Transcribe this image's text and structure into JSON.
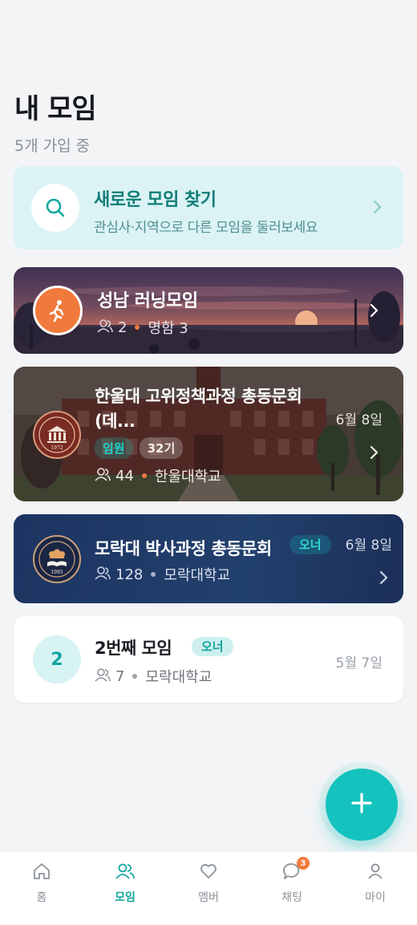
{
  "header": {
    "title": "내 모임",
    "subtitle": "5개 가입 중"
  },
  "discover": {
    "title": "새로운 모임 찾기",
    "description": "관심사·지역으로 다른 모임을 둘러보세요",
    "icon": "search-icon"
  },
  "groups": [
    {
      "name": "성남 러닝모임",
      "members": "2",
      "location": "명함 3",
      "avatar_icon": "runner-icon",
      "date": ""
    },
    {
      "name": "한울대 고위정책과정 총동문회 (데...",
      "members": "44",
      "location": "한울대학교",
      "date": "6월 8일",
      "tags": [
        "임원",
        "32기"
      ],
      "avatar_icon": "university-emblem-icon",
      "avatar_text": "1972"
    },
    {
      "name": "모락대 박사과정 총동문회",
      "members": "128",
      "location": "모락대학교",
      "date": "6월 8일",
      "role": "오너",
      "avatar_icon": "university-emblem-icon",
      "avatar_text": "1985"
    },
    {
      "name": "2번째 모임",
      "members": "7",
      "location": "모락대학교",
      "date": "5월 7일",
      "role": "오너",
      "avatar_text": "2"
    }
  ],
  "fab": {
    "icon": "plus-icon"
  },
  "tabbar": {
    "items": [
      {
        "label": "홈",
        "icon": "home-icon"
      },
      {
        "label": "모임",
        "icon": "people-icon",
        "active": true
      },
      {
        "label": "멤버",
        "icon": "heart-icon"
      },
      {
        "label": "채팅",
        "icon": "chat-icon",
        "badge": "3"
      },
      {
        "label": "마이",
        "icon": "person-icon"
      }
    ]
  },
  "colors": {
    "accent": "#14c3bd",
    "accent_dark": "#117e78",
    "orange": "#f07a3c",
    "navy": "#1d3461"
  }
}
